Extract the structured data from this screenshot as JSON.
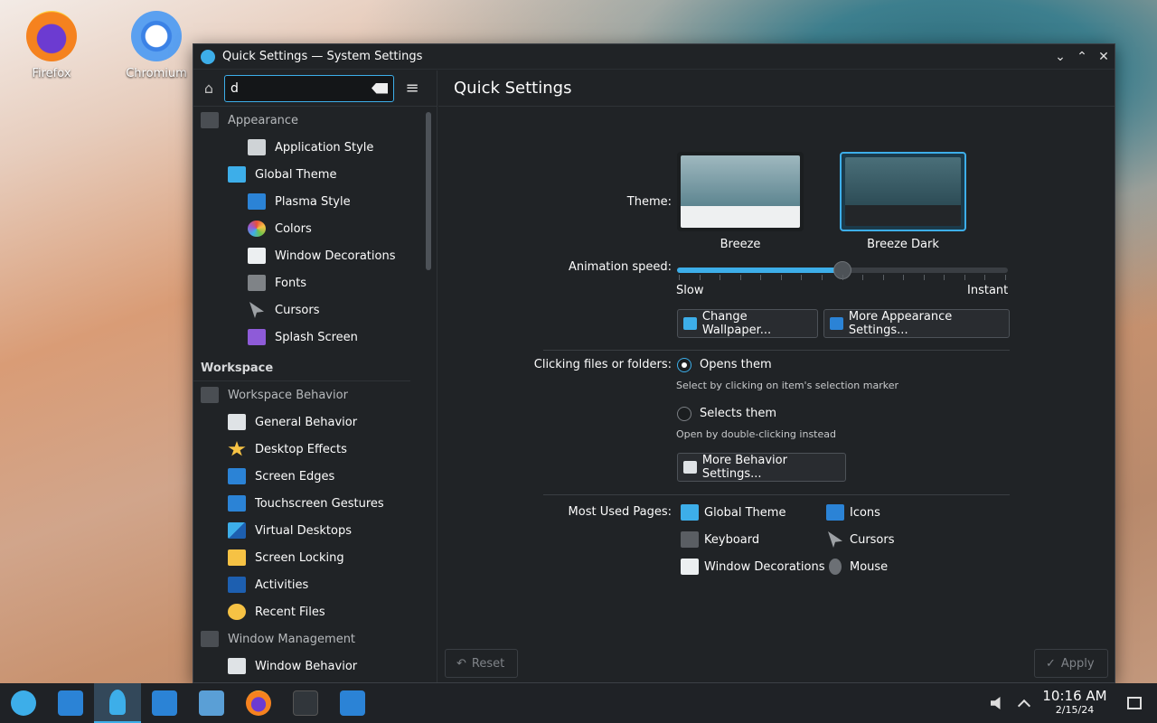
{
  "desktop": {
    "icons": [
      {
        "label": "Firefox"
      },
      {
        "label": "Chromium"
      }
    ]
  },
  "window": {
    "title": "Quick Settings — System Settings",
    "controls": {
      "minimize": "⌄",
      "maximize": "⌃",
      "close": "✕"
    }
  },
  "sidebar": {
    "search_value": "d",
    "menu_glyph": "≡",
    "home_glyph": "⌂",
    "groups": [
      {
        "label": "Appearance",
        "level": 0
      },
      {
        "label": "Application Style",
        "level": 2
      },
      {
        "label": "Global Theme",
        "level": 1
      },
      {
        "label": "Plasma Style",
        "level": 2
      },
      {
        "label": "Colors",
        "level": 2
      },
      {
        "label": "Window Decorations",
        "level": 2
      },
      {
        "label": "Fonts",
        "level": 2
      },
      {
        "label": "Cursors",
        "level": 2
      },
      {
        "label": "Splash Screen",
        "level": 2
      }
    ],
    "category_workspace": "Workspace",
    "workspace_items": [
      {
        "label": "Workspace Behavior",
        "level": 0
      },
      {
        "label": "General Behavior",
        "level": 1
      },
      {
        "label": "Desktop Effects",
        "level": 1
      },
      {
        "label": "Screen Edges",
        "level": 1
      },
      {
        "label": "Touchscreen Gestures",
        "level": 1
      },
      {
        "label": "Virtual Desktops",
        "level": 1
      },
      {
        "label": "Screen Locking",
        "level": 1
      },
      {
        "label": "Activities",
        "level": 1
      },
      {
        "label": "Recent Files",
        "level": 1
      },
      {
        "label": "Window Management",
        "level": 0
      },
      {
        "label": "Window Behavior",
        "level": 1
      }
    ]
  },
  "main": {
    "heading": "Quick Settings",
    "theme_label": "Theme:",
    "themes": [
      {
        "name": "Breeze",
        "selected": false
      },
      {
        "name": "Breeze Dark",
        "selected": true
      }
    ],
    "animation_label": "Animation speed:",
    "animation_slow": "Slow",
    "animation_instant": "Instant",
    "animation_value": 0.5,
    "change_wallpaper": "Change Wallpaper...",
    "more_appearance": "More Appearance Settings...",
    "clicking_label": "Clicking files or folders:",
    "opens_them": "Opens them",
    "opens_hint": "Select by clicking on item's selection marker",
    "selects_them": "Selects them",
    "selects_hint": "Open by double-clicking instead",
    "more_behavior": "More Behavior Settings...",
    "most_used_label": "Most Used Pages:",
    "most_used": [
      "Global Theme",
      "Icons",
      "Keyboard",
      "Cursors",
      "Window Decorations",
      "Mouse"
    ],
    "reset": "Reset",
    "apply": "Apply"
  },
  "taskbar": {
    "time": "10:16 AM",
    "date": "2/15/24"
  },
  "colors": {
    "accent": "#3daee9",
    "window_bg": "#202326"
  }
}
